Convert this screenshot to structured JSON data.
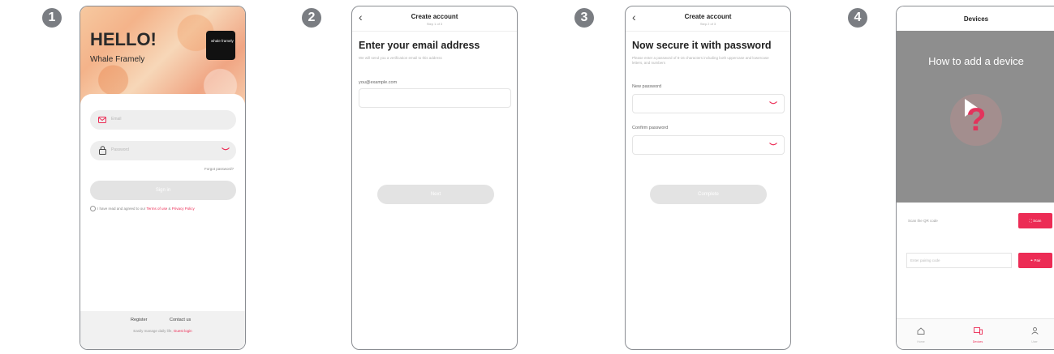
{
  "steps": [
    "1",
    "2",
    "3",
    "4"
  ],
  "phone1": {
    "greeting": "HELLO!",
    "app_name": "Whale Framely",
    "logo_text": "whale framely",
    "email_placeholder": "Email",
    "password_placeholder": "Password",
    "forgot": "Forgot password?",
    "sign_in": "Sign in",
    "agree_text": "I have read and agreed to our ",
    "terms": "Terms of use",
    "amp": " & ",
    "privacy": "Privacy Policy",
    "register": "Register",
    "contact": "Contact us",
    "tagline": "Easily manage daily life, ",
    "guest": "Guest login"
  },
  "phone2": {
    "title": "Create account",
    "step": "Step 1 of 3",
    "heading": "Enter your email address",
    "desc": "We will send you a verification email to this address",
    "email_label": "you@example.com",
    "next": "Next"
  },
  "phone3": {
    "title": "Create account",
    "step": "Step 2 of 3",
    "heading": "Now secure it with password",
    "desc": "Please enter a password of 8-16 characters including both uppercase and lowercase letters, and numbers",
    "new_label": "New password",
    "confirm_label": "Confirm password",
    "complete": "Complete"
  },
  "phone4": {
    "title": "Devices",
    "banner": "How to add a device",
    "scan_label": "Scan the QR code",
    "scan_btn": "Scan",
    "pair_placeholder": "Enter pairing code",
    "pair_btn": "Pair",
    "tabs": [
      "Home",
      "Devices",
      "User"
    ]
  },
  "colors": {
    "accent": "#ec2c55",
    "badge": "#7a7d82",
    "button_disabled": "#e3e3e3"
  }
}
